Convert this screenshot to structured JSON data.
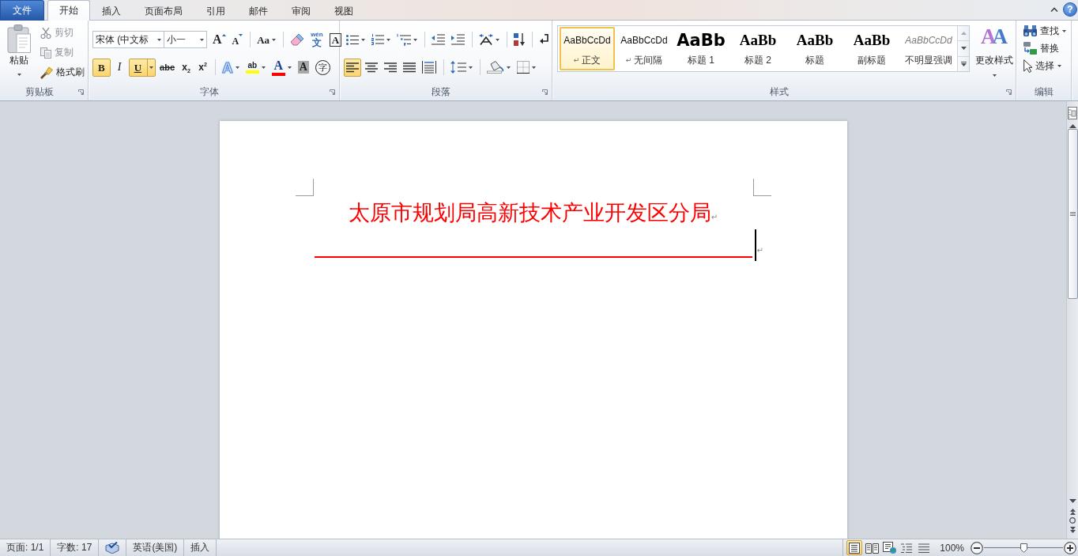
{
  "help": "?",
  "tabs": [
    {
      "label": "文件",
      "kind": "file",
      "selected": false
    },
    {
      "label": "开始",
      "kind": "tab",
      "selected": true
    },
    {
      "label": "插入",
      "kind": "tab",
      "selected": false
    },
    {
      "label": "页面布局",
      "kind": "tab",
      "selected": false
    },
    {
      "label": "引用",
      "kind": "tab",
      "selected": false
    },
    {
      "label": "邮件",
      "kind": "tab",
      "selected": false
    },
    {
      "label": "审阅",
      "kind": "tab",
      "selected": false
    },
    {
      "label": "视图",
      "kind": "tab",
      "selected": false
    }
  ],
  "ribbon": {
    "clipboard": {
      "title": "剪贴板",
      "launcher": true,
      "paste": "粘贴",
      "commands": [
        {
          "kind": "cut",
          "label": "剪切",
          "disabled": true
        },
        {
          "kind": "copy",
          "label": "复制",
          "disabled": true
        },
        {
          "kind": "format_painter",
          "label": "格式刷",
          "disabled": false
        }
      ]
    },
    "font": {
      "title": "字体",
      "launcher": true,
      "font_name": "宋体 (中文标",
      "font_size": "小一",
      "toolbars": [
        {
          "clusters": [
            {
              "buttons": [
                {
                  "kind": "grow",
                  "glyph": "A"
                },
                {
                  "kind": "shrink",
                  "glyph": "A"
                }
              ]
            },
            {
              "buttons": [
                {
                  "kind": "case",
                  "glyph": "Aa",
                  "dropdown": true
                }
              ]
            },
            {
              "buttons": [
                {
                  "kind": "clear"
                },
                {
                  "kind": "phonetic",
                  "glyph": "wén",
                  "glyph2": "文"
                },
                {
                  "kind": "border",
                  "glyph": "A"
                }
              ]
            }
          ]
        },
        {
          "clusters": [
            {
              "buttons": [
                {
                  "kind": "bold",
                  "glyph": "B",
                  "on": true
                },
                {
                  "kind": "italic",
                  "glyph": "I",
                  "on": false
                },
                {
                  "kind": "underline",
                  "glyph": "U",
                  "on": true,
                  "dropdown": true
                },
                {
                  "kind": "strike",
                  "glyph": "abc",
                  "on": false
                },
                {
                  "kind": "sub",
                  "glyph": "x$_{2}$",
                  "on": false
                },
                {
                  "kind": "sup",
                  "glyph": "x$^{2}$",
                  "on": false
                }
              ]
            },
            {
              "buttons": [
                {
                  "kind": "effects",
                  "glyph": "A",
                  "dropdown": true
                },
                {
                  "kind": "highlight",
                  "glyph": "ab",
                  "color": "#ffff00",
                  "dropdown": true
                },
                {
                  "kind": "color",
                  "glyph": "A",
                  "color": "#ff0000",
                  "dropdown": true
                },
                {
                  "kind": "shading",
                  "glyph": "A"
                },
                {
                  "kind": "enclose",
                  "glyph": "字"
                }
              ]
            }
          ]
        }
      ]
    },
    "paragraph": {
      "title": "段落",
      "launcher": true,
      "toolbars": [
        {
          "clusters": [
            {
              "buttons": [
                {
                  "kind": "bullets",
                  "dropdown": true
                },
                {
                  "kind": "numbering",
                  "dropdown": true
                },
                {
                  "kind": "multilevel",
                  "dropdown": true
                }
              ]
            },
            {
              "buttons": [
                {
                  "kind": "outdent"
                },
                {
                  "kind": "indent"
                }
              ]
            },
            {
              "buttons": [
                {
                  "kind": "asian",
                  "dropdown": true
                }
              ]
            },
            {
              "buttons": [
                {
                  "kind": "sort"
                }
              ]
            },
            {
              "buttons": [
                {
                  "kind": "marks"
                }
              ]
            }
          ]
        },
        {
          "clusters": [
            {
              "buttons": [
                {
                  "kind": "left",
                  "selected": true
                },
                {
                  "kind": "center",
                  "selected": false
                },
                {
                  "kind": "right",
                  "selected": false
                },
                {
                  "kind": "justify",
                  "selected": false
                },
                {
                  "kind": "distribute",
                  "selected": false
                }
              ]
            },
            {
              "buttons": [
                {
                  "kind": "spacing",
                  "dropdown": true
                }
              ]
            },
            {
              "buttons": [
                {
                  "kind": "shading",
                  "dropdown": true
                },
                {
                  "kind": "borders",
                  "dropdown": true
                }
              ]
            }
          ]
        }
      ]
    },
    "styles": {
      "title": "样式",
      "launcher": true,
      "gallery": [
        {
          "kind": "normal",
          "preview": "AaBbCcDd",
          "mark": "↵",
          "label": "正文",
          "selected": true
        },
        {
          "kind": "normal",
          "preview": "AaBbCcDd",
          "mark": "↵",
          "label": "无间隔",
          "selected": false
        },
        {
          "kind": "heading_1",
          "preview": "AaBb",
          "label": "标题 1",
          "selected": false
        },
        {
          "kind": "heading_2",
          "preview": "AaBb",
          "label": "标题 2",
          "selected": false
        },
        {
          "kind": "title",
          "preview": "AaBb",
          "label": "标题",
          "selected": false
        },
        {
          "kind": "subtitle",
          "preview": "AaBb",
          "label": "副标题",
          "selected": false
        },
        {
          "kind": "emphasis",
          "preview": "AaBbCcDd",
          "label": "不明显强调",
          "selected": false
        }
      ],
      "change_styles": {
        "label": "更改样式",
        "glyph": "AA",
        "dropdown": true
      }
    },
    "editing": {
      "title": "编辑",
      "commands": [
        {
          "kind": "find",
          "label": "查找",
          "dropdown": true
        },
        {
          "kind": "replace",
          "label": "替换"
        },
        {
          "kind": "select",
          "label": "选择",
          "dropdown": true
        }
      ]
    }
  },
  "document": {
    "paragraphs": [
      {
        "kind": "heading",
        "text": "太原市规划局高新技术产业开发区分局",
        "mark": "↵"
      },
      {
        "kind": "rule",
        "mark": "↵",
        "cursor": true
      }
    ]
  },
  "status_bar": {
    "items": [
      {
        "kind": "page",
        "label": "页面: 1/1"
      },
      {
        "kind": "words",
        "label": "字数: 17"
      },
      {
        "kind": "proofing"
      },
      {
        "kind": "language",
        "label": "英语(美国)"
      },
      {
        "kind": "mode",
        "label": "插入"
      }
    ],
    "views": [
      {
        "kind": "print",
        "selected": true
      },
      {
        "kind": "reading",
        "selected": false
      },
      {
        "kind": "web",
        "selected": false
      },
      {
        "kind": "outline",
        "selected": false
      },
      {
        "kind": "draft",
        "selected": false
      }
    ],
    "zoom": "100%",
    "zoom_slider": {
      "level": 0.5
    }
  }
}
